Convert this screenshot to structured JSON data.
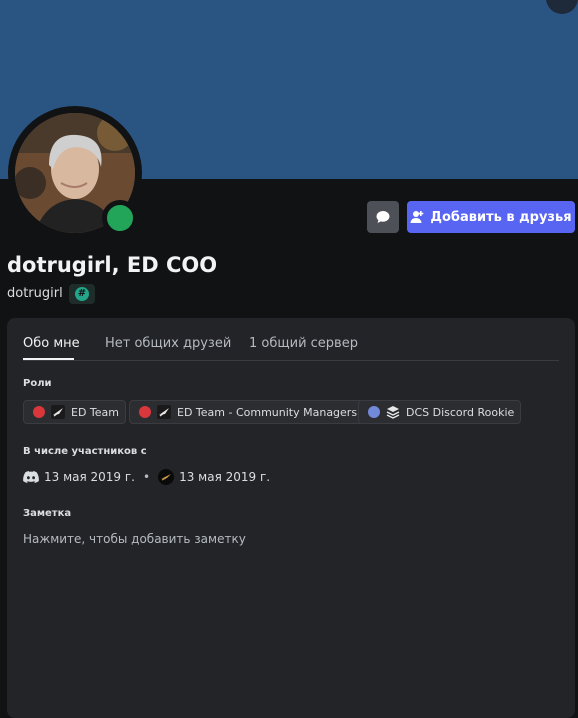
{
  "profile": {
    "display_name": "dotrugirl, ED COO",
    "username": "dotrugirl",
    "badge_symbol": "#",
    "status_color": "#23a559",
    "banner_color": "#2a5583"
  },
  "actions": {
    "add_friend_label": "Добавить в друзья",
    "accent_color": "#5865f2"
  },
  "tabs": [
    {
      "label": "Обо мне",
      "active": true
    },
    {
      "label": "Нет общих друзей",
      "active": false
    },
    {
      "label": "1 общий сервер",
      "active": false
    }
  ],
  "roles": {
    "title": "Роли",
    "items": [
      {
        "name": "ED Team",
        "color": "#da373c",
        "icon": "arrow-logo-icon"
      },
      {
        "name": "ED Team - Community Managers",
        "color": "#da373c",
        "icon": "arrow-logo-icon"
      },
      {
        "name": "DCS Discord Rookie",
        "color": "#7289da",
        "icon": "stack-icon"
      }
    ]
  },
  "member_since": {
    "title": "В числе участников с",
    "discord_date": "13 мая 2019 г.",
    "separator": "•",
    "server_date": "13 мая 2019 г."
  },
  "note": {
    "title": "Заметка",
    "placeholder": "Нажмите, чтобы добавить заметку"
  }
}
